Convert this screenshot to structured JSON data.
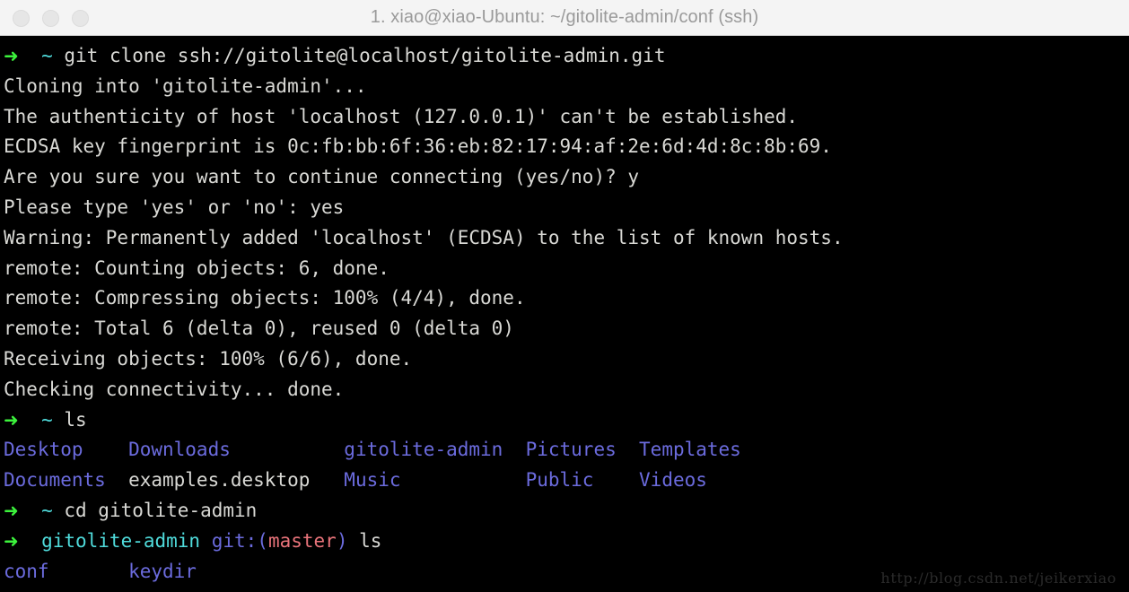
{
  "window": {
    "title": "1. xiao@xiao-Ubuntu: ~/gitolite-admin/conf (ssh)",
    "titlebar_bg": "#f4f4f4",
    "terminal_bg": "#000000",
    "controls": [
      {
        "name": "close",
        "color": "#e6e6e6"
      },
      {
        "name": "minimize",
        "color": "#e6e6e6"
      },
      {
        "name": "zoom",
        "color": "#e6e6e6"
      }
    ]
  },
  "colors": {
    "foreground": "#d9d9d5",
    "prompt_arrow": "#3cf23c",
    "prompt_path": "#4fdbdb",
    "directory": "#6b6bdd",
    "git_branch": "#e8737a",
    "git_label": "#6b6bdd"
  },
  "terminal": {
    "lines": [
      {
        "type": "prompt",
        "arrow": "➜",
        "path": "~",
        "command": "git clone ssh://gitolite@localhost/gitolite-admin.git"
      },
      {
        "type": "output",
        "text": "Cloning into 'gitolite-admin'..."
      },
      {
        "type": "output",
        "text": "The authenticity of host 'localhost (127.0.0.1)' can't be established."
      },
      {
        "type": "output",
        "text": "ECDSA key fingerprint is 0c:fb:bb:6f:36:eb:82:17:94:af:2e:6d:4d:8c:8b:69."
      },
      {
        "type": "output",
        "text": "Are you sure you want to continue connecting (yes/no)? y"
      },
      {
        "type": "output",
        "text": "Please type 'yes' or 'no': yes"
      },
      {
        "type": "output",
        "text": "Warning: Permanently added 'localhost' (ECDSA) to the list of known hosts."
      },
      {
        "type": "output",
        "text": "remote: Counting objects: 6, done."
      },
      {
        "type": "output",
        "text": "remote: Compressing objects: 100% (4/4), done."
      },
      {
        "type": "output",
        "text": "remote: Total 6 (delta 0), reused 0 (delta 0)"
      },
      {
        "type": "output",
        "text": "Receiving objects: 100% (6/6), done."
      },
      {
        "type": "output",
        "text": "Checking connectivity... done."
      },
      {
        "type": "prompt",
        "arrow": "➜",
        "path": "~",
        "command": "ls"
      },
      {
        "type": "listing",
        "entries": [
          {
            "name": "Desktop",
            "kind": "dir"
          },
          {
            "name": "Downloads",
            "kind": "dir"
          },
          {
            "name": "gitolite-admin",
            "kind": "dir"
          },
          {
            "name": "Pictures",
            "kind": "dir"
          },
          {
            "name": "Templates",
            "kind": "dir"
          }
        ]
      },
      {
        "type": "listing",
        "entries": [
          {
            "name": "Documents",
            "kind": "dir"
          },
          {
            "name": "examples.desktop",
            "kind": "file"
          },
          {
            "name": "Music",
            "kind": "dir"
          },
          {
            "name": "Public",
            "kind": "dir"
          },
          {
            "name": "Videos",
            "kind": "dir"
          }
        ]
      },
      {
        "type": "prompt",
        "arrow": "➜",
        "path": "~",
        "command": "cd gitolite-admin"
      },
      {
        "type": "git-prompt",
        "arrow": "➜",
        "path": "gitolite-admin",
        "git_open": "git:(",
        "branch": "master",
        "git_close": ")",
        "command": "ls"
      },
      {
        "type": "listing",
        "entries": [
          {
            "name": "conf",
            "kind": "dir"
          },
          {
            "name": "keydir",
            "kind": "dir"
          }
        ]
      }
    ],
    "listing_columns": [
      11,
      19,
      16,
      10,
      10
    ]
  },
  "watermark": {
    "text": "http://blog.csdn.net/jeikerxiao"
  }
}
